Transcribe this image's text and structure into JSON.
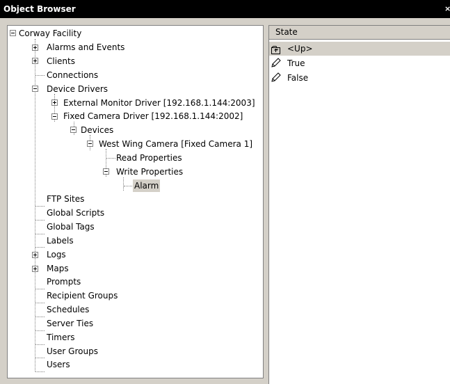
{
  "window": {
    "title": "Object Browser",
    "close_glyph": "×"
  },
  "tree": {
    "root": "Corway Facility",
    "items": {
      "alarms_and_events": "Alarms and Events",
      "clients": "Clients",
      "connections": "Connections",
      "device_drivers": "Device Drivers",
      "external_monitor_driver": "External Monitor Driver [192.168.1.144:2003]",
      "fixed_camera_driver": "Fixed Camera Driver [192.168.1.144:2002]",
      "devices": "Devices",
      "west_wing_camera": "West Wing Camera [Fixed Camera 1]",
      "read_properties": "Read Properties",
      "write_properties": "Write Properties",
      "alarm": "Alarm",
      "ftp_sites": "FTP Sites",
      "global_scripts": "Global Scripts",
      "global_tags": "Global Tags",
      "labels": "Labels",
      "logs": "Logs",
      "maps": "Maps",
      "prompts": "Prompts",
      "recipient_groups": "Recipient Groups",
      "schedules": "Schedules",
      "server_ties": "Server Ties",
      "timers": "Timers",
      "user_groups": "User Groups",
      "users": "Users"
    }
  },
  "list": {
    "column_header": "State",
    "rows": [
      {
        "label": "<Up>",
        "icon": "up-folder-icon"
      },
      {
        "label": "True",
        "icon": "pencil-icon"
      },
      {
        "label": "False",
        "icon": "pencil-icon"
      }
    ]
  }
}
